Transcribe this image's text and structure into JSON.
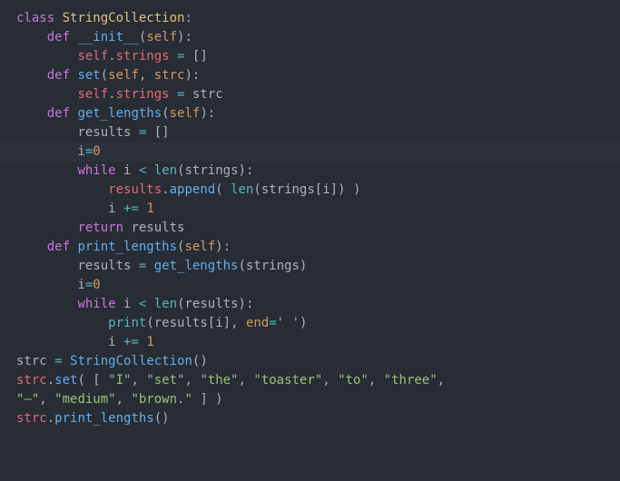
{
  "code": {
    "lines": [
      {
        "highlighted": false,
        "tokens": [
          {
            "cls": "kw",
            "t": "class "
          },
          {
            "cls": "def-name",
            "t": "StringCollection"
          },
          {
            "cls": "punct",
            "t": ":"
          }
        ]
      },
      {
        "highlighted": false,
        "tokens": [
          {
            "cls": "plain",
            "t": "    "
          },
          {
            "cls": "kw",
            "t": "def "
          },
          {
            "cls": "fn-name",
            "t": "__init__"
          },
          {
            "cls": "punct",
            "t": "("
          },
          {
            "cls": "param",
            "t": "self"
          },
          {
            "cls": "punct",
            "t": "):"
          }
        ]
      },
      {
        "highlighted": false,
        "tokens": [
          {
            "cls": "plain",
            "t": "        "
          },
          {
            "cls": "self",
            "t": "self"
          },
          {
            "cls": "punct",
            "t": "."
          },
          {
            "cls": "attr",
            "t": "strings"
          },
          {
            "cls": "plain",
            "t": " "
          },
          {
            "cls": "op",
            "t": "="
          },
          {
            "cls": "plain",
            "t": " "
          },
          {
            "cls": "punct",
            "t": "[]"
          }
        ]
      },
      {
        "highlighted": false,
        "tokens": [
          {
            "cls": "plain",
            "t": "    "
          },
          {
            "cls": "kw",
            "t": "def "
          },
          {
            "cls": "fn-name",
            "t": "set"
          },
          {
            "cls": "punct",
            "t": "("
          },
          {
            "cls": "param",
            "t": "self"
          },
          {
            "cls": "punct",
            "t": ", "
          },
          {
            "cls": "param",
            "t": "strc"
          },
          {
            "cls": "punct",
            "t": "):"
          }
        ]
      },
      {
        "highlighted": false,
        "tokens": [
          {
            "cls": "plain",
            "t": "        "
          },
          {
            "cls": "self",
            "t": "self"
          },
          {
            "cls": "punct",
            "t": "."
          },
          {
            "cls": "attr",
            "t": "strings"
          },
          {
            "cls": "plain",
            "t": " "
          },
          {
            "cls": "op",
            "t": "="
          },
          {
            "cls": "plain",
            "t": " strc"
          }
        ]
      },
      {
        "highlighted": false,
        "tokens": [
          {
            "cls": "plain",
            "t": "    "
          },
          {
            "cls": "kw",
            "t": "def "
          },
          {
            "cls": "fn-name",
            "t": "get_lengths"
          },
          {
            "cls": "punct",
            "t": "("
          },
          {
            "cls": "param",
            "t": "self"
          },
          {
            "cls": "punct",
            "t": "):"
          }
        ]
      },
      {
        "highlighted": false,
        "tokens": [
          {
            "cls": "plain",
            "t": "        results "
          },
          {
            "cls": "op",
            "t": "="
          },
          {
            "cls": "plain",
            "t": " "
          },
          {
            "cls": "punct",
            "t": "[]"
          }
        ]
      },
      {
        "highlighted": true,
        "tokens": [
          {
            "cls": "plain",
            "t": "        i"
          },
          {
            "cls": "op",
            "t": "="
          },
          {
            "cls": "num",
            "t": "0"
          }
        ]
      },
      {
        "highlighted": false,
        "tokens": [
          {
            "cls": "plain",
            "t": "        "
          },
          {
            "cls": "kw",
            "t": "while"
          },
          {
            "cls": "plain",
            "t": " i "
          },
          {
            "cls": "op",
            "t": "<"
          },
          {
            "cls": "plain",
            "t": " "
          },
          {
            "cls": "builtin",
            "t": "len"
          },
          {
            "cls": "punct",
            "t": "("
          },
          {
            "cls": "plain",
            "t": "strings"
          },
          {
            "cls": "punct",
            "t": "):"
          }
        ]
      },
      {
        "highlighted": false,
        "tokens": [
          {
            "cls": "plain",
            "t": "            "
          },
          {
            "cls": "var",
            "t": "results"
          },
          {
            "cls": "punct",
            "t": "."
          },
          {
            "cls": "fn-name",
            "t": "append"
          },
          {
            "cls": "punct",
            "t": "( "
          },
          {
            "cls": "builtin",
            "t": "len"
          },
          {
            "cls": "punct",
            "t": "("
          },
          {
            "cls": "plain",
            "t": "strings"
          },
          {
            "cls": "punct",
            "t": "["
          },
          {
            "cls": "plain",
            "t": "i"
          },
          {
            "cls": "punct",
            "t": "]) )"
          }
        ]
      },
      {
        "highlighted": false,
        "tokens": [
          {
            "cls": "plain",
            "t": "            i "
          },
          {
            "cls": "op",
            "t": "+="
          },
          {
            "cls": "plain",
            "t": " "
          },
          {
            "cls": "num",
            "t": "1"
          }
        ]
      },
      {
        "highlighted": false,
        "tokens": [
          {
            "cls": "plain",
            "t": "        "
          },
          {
            "cls": "kw",
            "t": "return"
          },
          {
            "cls": "plain",
            "t": " results"
          }
        ]
      },
      {
        "highlighted": false,
        "tokens": [
          {
            "cls": "plain",
            "t": "    "
          },
          {
            "cls": "kw",
            "t": "def "
          },
          {
            "cls": "fn-name",
            "t": "print_lengths"
          },
          {
            "cls": "punct",
            "t": "("
          },
          {
            "cls": "param",
            "t": "self"
          },
          {
            "cls": "punct",
            "t": "):"
          }
        ]
      },
      {
        "highlighted": false,
        "tokens": [
          {
            "cls": "plain",
            "t": "        results "
          },
          {
            "cls": "op",
            "t": "="
          },
          {
            "cls": "plain",
            "t": " "
          },
          {
            "cls": "fn-name",
            "t": "get_lengths"
          },
          {
            "cls": "punct",
            "t": "("
          },
          {
            "cls": "plain",
            "t": "strings"
          },
          {
            "cls": "punct",
            "t": ")"
          }
        ]
      },
      {
        "highlighted": false,
        "tokens": [
          {
            "cls": "plain",
            "t": "        i"
          },
          {
            "cls": "op",
            "t": "="
          },
          {
            "cls": "num",
            "t": "0"
          }
        ]
      },
      {
        "highlighted": false,
        "tokens": [
          {
            "cls": "plain",
            "t": "        "
          },
          {
            "cls": "kw",
            "t": "while"
          },
          {
            "cls": "plain",
            "t": " i "
          },
          {
            "cls": "op",
            "t": "<"
          },
          {
            "cls": "plain",
            "t": " "
          },
          {
            "cls": "builtin",
            "t": "len"
          },
          {
            "cls": "punct",
            "t": "("
          },
          {
            "cls": "plain",
            "t": "results"
          },
          {
            "cls": "punct",
            "t": "):"
          }
        ]
      },
      {
        "highlighted": false,
        "tokens": [
          {
            "cls": "plain",
            "t": "            "
          },
          {
            "cls": "builtin",
            "t": "print"
          },
          {
            "cls": "punct",
            "t": "("
          },
          {
            "cls": "plain",
            "t": "results"
          },
          {
            "cls": "punct",
            "t": "["
          },
          {
            "cls": "plain",
            "t": "i"
          },
          {
            "cls": "punct",
            "t": "], "
          },
          {
            "cls": "param",
            "t": "end"
          },
          {
            "cls": "op",
            "t": "="
          },
          {
            "cls": "str",
            "t": "' '"
          },
          {
            "cls": "punct",
            "t": ")"
          }
        ]
      },
      {
        "highlighted": false,
        "tokens": [
          {
            "cls": "plain",
            "t": "            i "
          },
          {
            "cls": "op",
            "t": "+="
          },
          {
            "cls": "plain",
            "t": " "
          },
          {
            "cls": "num",
            "t": "1"
          }
        ]
      },
      {
        "highlighted": false,
        "tokens": [
          {
            "cls": "plain",
            "t": "strc "
          },
          {
            "cls": "op",
            "t": "="
          },
          {
            "cls": "plain",
            "t": " "
          },
          {
            "cls": "fn-name",
            "t": "StringCollection"
          },
          {
            "cls": "punct",
            "t": "()"
          }
        ]
      },
      {
        "highlighted": false,
        "tokens": [
          {
            "cls": "var",
            "t": "strc"
          },
          {
            "cls": "punct",
            "t": "."
          },
          {
            "cls": "fn-name",
            "t": "set"
          },
          {
            "cls": "punct",
            "t": "( [ "
          },
          {
            "cls": "str",
            "t": "\"I\""
          },
          {
            "cls": "punct",
            "t": ", "
          },
          {
            "cls": "str",
            "t": "\"set\""
          },
          {
            "cls": "punct",
            "t": ", "
          },
          {
            "cls": "str",
            "t": "\"the\""
          },
          {
            "cls": "punct",
            "t": ", "
          },
          {
            "cls": "str",
            "t": "\"toaster\""
          },
          {
            "cls": "punct",
            "t": ", "
          },
          {
            "cls": "str",
            "t": "\"to\""
          },
          {
            "cls": "punct",
            "t": ", "
          },
          {
            "cls": "str",
            "t": "\"three\""
          },
          {
            "cls": "punct",
            "t": ","
          }
        ]
      },
      {
        "highlighted": false,
        "tokens": [
          {
            "cls": "str",
            "t": "\"—\""
          },
          {
            "cls": "punct",
            "t": ", "
          },
          {
            "cls": "str",
            "t": "\"medium\""
          },
          {
            "cls": "punct",
            "t": ", "
          },
          {
            "cls": "str",
            "t": "\"brown.\""
          },
          {
            "cls": "punct",
            "t": " ] )"
          }
        ]
      },
      {
        "highlighted": false,
        "tokens": [
          {
            "cls": "var",
            "t": "strc"
          },
          {
            "cls": "punct",
            "t": "."
          },
          {
            "cls": "fn-name",
            "t": "print_lengths"
          },
          {
            "cls": "punct",
            "t": "()"
          }
        ]
      }
    ]
  }
}
